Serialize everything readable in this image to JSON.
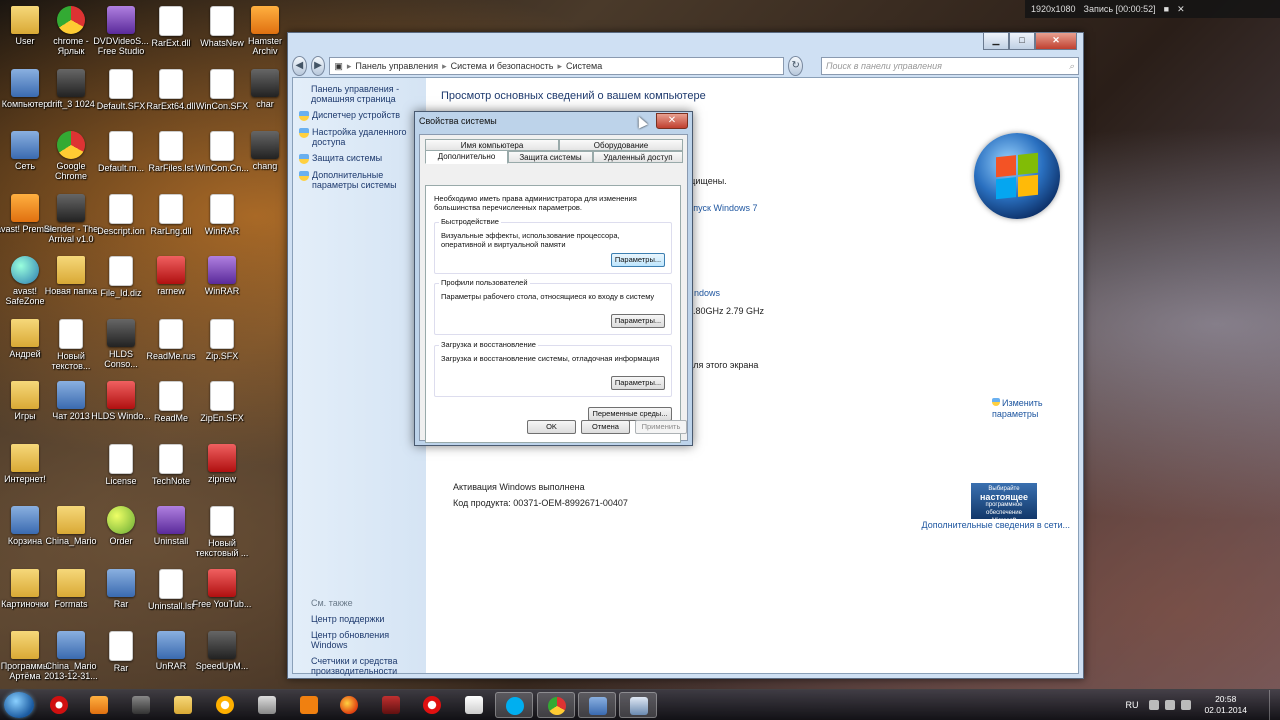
{
  "desktop_icons": [
    {
      "label": "User",
      "kind": "folder"
    },
    {
      "label": "chrome - Ярлык",
      "kind": "chrome"
    },
    {
      "label": "DVDVideoS... Free Studio",
      "kind": "purple"
    },
    {
      "label": "RarExt.dll",
      "kind": "doc"
    },
    {
      "label": "WhatsNew",
      "kind": "doc"
    },
    {
      "label": "Hamster Archiv",
      "kind": "orange"
    },
    {
      "label": "Компьютер",
      "kind": "app"
    },
    {
      "label": "drift_3 1024",
      "kind": "dark"
    },
    {
      "label": "Default.SFX",
      "kind": "doc"
    },
    {
      "label": "RarExt64.dll",
      "kind": "doc"
    },
    {
      "label": "WinCon.SFX",
      "kind": "doc"
    },
    {
      "label": "char",
      "kind": "dark"
    },
    {
      "label": "Сеть",
      "kind": "app"
    },
    {
      "label": "Google Chrome",
      "kind": "chrome"
    },
    {
      "label": "Default.m...",
      "kind": "doc"
    },
    {
      "label": "RarFiles.lst",
      "kind": "doc"
    },
    {
      "label": "WinCon.Cn...",
      "kind": "doc"
    },
    {
      "label": "chang",
      "kind": "dark"
    },
    {
      "label": "avast! Premier",
      "kind": "orange"
    },
    {
      "label": "Slender - The Arrival v1.0",
      "kind": "dark"
    },
    {
      "label": "Descript.ion",
      "kind": "doc"
    },
    {
      "label": "RarLng.dll",
      "kind": "doc"
    },
    {
      "label": "WinRAR",
      "kind": "doc"
    },
    {
      "label": "avast! SafeZone",
      "kind": "globe"
    },
    {
      "label": "Новая папка",
      "kind": "folder"
    },
    {
      "label": "File_Id.diz",
      "kind": "doc"
    },
    {
      "label": "rarnew",
      "kind": "red"
    },
    {
      "label": "WinRAR",
      "kind": "purple"
    },
    {
      "label": "Андрей",
      "kind": "folder"
    },
    {
      "label": "Новый текстов...",
      "kind": "doc"
    },
    {
      "label": "HLDS Conso...",
      "kind": "dark"
    },
    {
      "label": "ReadMe.rus",
      "kind": "doc"
    },
    {
      "label": "Zip.SFX",
      "kind": "doc"
    },
    {
      "label": "Игры",
      "kind": "folder"
    },
    {
      "label": "Чат 2013",
      "kind": "app"
    },
    {
      "label": "HLDS Windo...",
      "kind": "red"
    },
    {
      "label": "ReadMe",
      "kind": "doc"
    },
    {
      "label": "ZipEn.SFX",
      "kind": "doc"
    },
    {
      "label": "Интернет!",
      "kind": "folder"
    },
    {
      "label": "License",
      "kind": "doc"
    },
    {
      "label": "TechNote",
      "kind": "doc"
    },
    {
      "label": "zipnew",
      "kind": "red"
    },
    {
      "label": "Корзина",
      "kind": "app"
    },
    {
      "label": "China_Mario",
      "kind": "folder"
    },
    {
      "label": "Order",
      "kind": "green"
    },
    {
      "label": "Uninstall",
      "kind": "purple"
    },
    {
      "label": "Новый текстовый ...",
      "kind": "doc"
    },
    {
      "label": "Картиночки",
      "kind": "folder"
    },
    {
      "label": "Formats",
      "kind": "folder"
    },
    {
      "label": "Rar",
      "kind": "app"
    },
    {
      "label": "Uninstall.lst",
      "kind": "doc"
    },
    {
      "label": "Free YouTub...",
      "kind": "red"
    },
    {
      "label": "Программы Артёма",
      "kind": "folder"
    },
    {
      "label": "China_Mario 2013-12-31...",
      "kind": "app"
    },
    {
      "label": "Rar",
      "kind": "doc"
    },
    {
      "label": "UnRAR",
      "kind": "app"
    },
    {
      "label": "SpeedUpM...",
      "kind": "dark"
    }
  ],
  "recorder": {
    "resolution": "1920x1080",
    "record_label": "Запись [00:00:52]"
  },
  "explorer": {
    "address_parts": [
      "Панель управления",
      "Система и безопасность",
      "Система"
    ],
    "search_placeholder": "Поиск в панели управления",
    "left_pane": {
      "home_link": "Панель управления - домашняя страница",
      "links": [
        "Диспетчер устройств",
        "Настройка удаленного доступа",
        "Защита системы",
        "Дополнительные параметры системы"
      ],
      "see_also_heading": "См. также",
      "see_also": [
        "Центр поддержки",
        "Центр обновления Windows",
        "Счетчики и средства производительности"
      ]
    },
    "main": {
      "title": "Просмотр основных сведений о вашем компьютере",
      "frag_reserved": "щищены.",
      "frag_edition": "выпуск Windows 7",
      "frag_windows": "ndows",
      "frag_cpu": "2.80GHz   2.79 GHz",
      "frag_screen": "для этого экрана",
      "change_settings": "Изменить параметры",
      "activation": "Активация Windows выполнена",
      "product_key": "Код продукта: 00371-OEM-8992671-00407",
      "genuine_line1": "Выбирайте",
      "genuine_line2": "настоящее",
      "genuine_line3": "программное обеспечение",
      "genuine_line4": "Microsoft",
      "more_info": "Дополнительные сведения в сети..."
    }
  },
  "dialog": {
    "title": "Свойства системы",
    "tabs_top": [
      "Имя компьютера",
      "Оборудование"
    ],
    "tabs_bottom": [
      "Дополнительно",
      "Защита системы",
      "Удаленный доступ"
    ],
    "admin_note": "Необходимо иметь права администратора для изменения большинства перечисленных параметров.",
    "performance_title": "Быстродействие",
    "performance_text": "Визуальные эффекты, использование процессора, оперативной и виртуальной памяти",
    "profiles_title": "Профили пользователей",
    "profiles_text": "Параметры рабочего стола, относящиеся ко входу в систему",
    "startup_title": "Загрузка и восстановление",
    "startup_text": "Загрузка и восстановление системы, отладочная информация",
    "params_label": "Параметры...",
    "env_label": "Переменные среды...",
    "ok_label": "OK",
    "cancel_label": "Отмена",
    "apply_label": "Применить"
  },
  "taskbar": {
    "lang": "RU",
    "time": "20:58",
    "date": "02.01.2014"
  }
}
